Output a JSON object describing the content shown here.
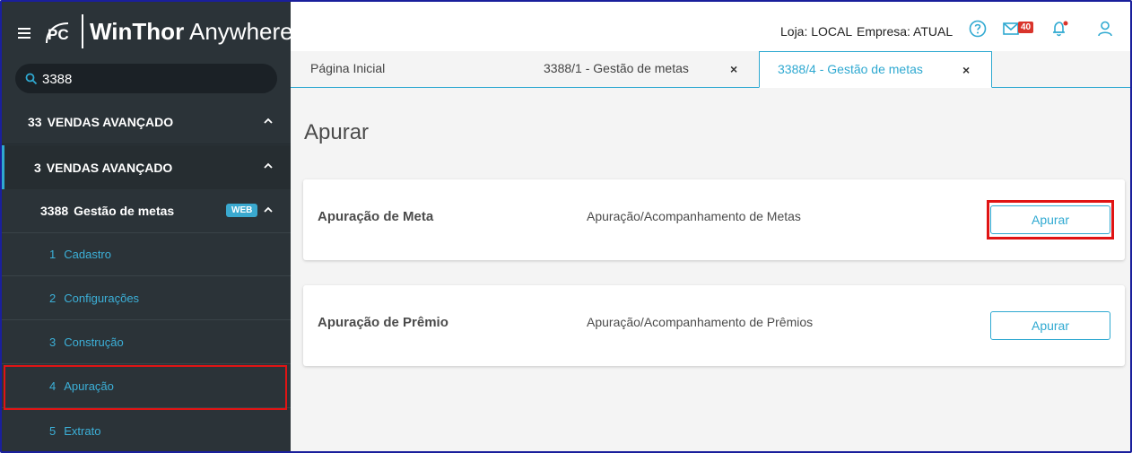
{
  "app": {
    "brand_logo": "PC",
    "title_bold": "WinThor",
    "title_light": "Anywhere"
  },
  "search": {
    "value": "3388"
  },
  "sidebar": {
    "items": [
      {
        "num": "33",
        "label": "VENDAS AVANÇADO"
      },
      {
        "num": "3",
        "label": "VENDAS AVANÇADO"
      },
      {
        "num": "3388",
        "label": "Gestão de metas",
        "badge": "WEB"
      }
    ],
    "subitems": [
      {
        "num": "1",
        "label": "Cadastro"
      },
      {
        "num": "2",
        "label": "Configurações"
      },
      {
        "num": "3",
        "label": "Construção"
      },
      {
        "num": "4",
        "label": "Apuração"
      },
      {
        "num": "5",
        "label": "Extrato"
      }
    ]
  },
  "header": {
    "loja": "Loja: LOCAL",
    "empresa": "Empresa: ATUAL",
    "mail_count": "40",
    "accent_color": "#2fa9d1",
    "badge_color": "#d9342b"
  },
  "tabs": [
    {
      "label": "Página Inicial"
    },
    {
      "label": "3388/1 - Gestão de metas",
      "close": "×"
    },
    {
      "label": "3388/4 - Gestão de metas",
      "close": "×"
    }
  ],
  "main": {
    "title": "Apurar",
    "cards": [
      {
        "title": "Apuração de Meta",
        "description": "Apuração/Acompanhamento de Metas",
        "button": "Apurar"
      },
      {
        "title": "Apuração de Prêmio",
        "description": "Apuração/Acompanhamento de Prêmios",
        "button": "Apurar"
      }
    ]
  }
}
